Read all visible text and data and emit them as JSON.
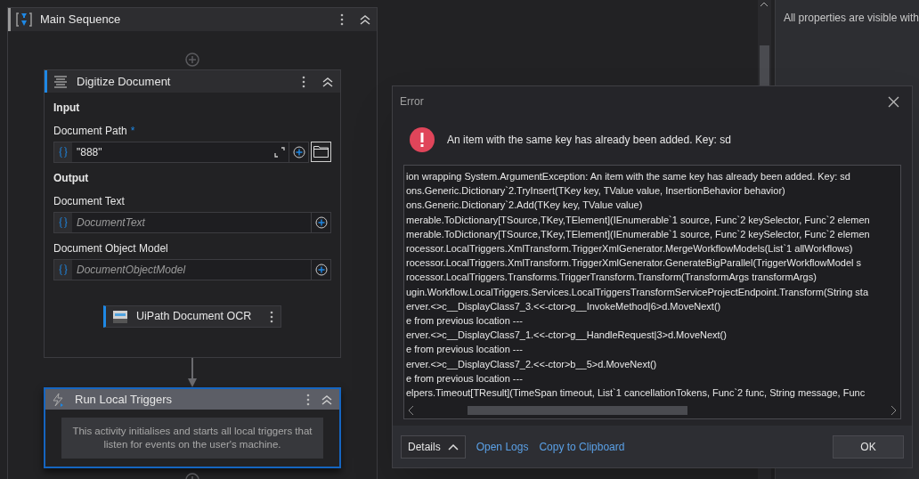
{
  "sequence": {
    "title": "Main Sequence"
  },
  "digitize": {
    "title": "Digitize Document",
    "sections": [
      {
        "heading": "Input",
        "fields": [
          {
            "label": "Document Path",
            "required_mark": "*",
            "value": "\"888\"",
            "kind": "path"
          }
        ]
      },
      {
        "heading": "Output",
        "fields": [
          {
            "label": "Document Text",
            "placeholder": "DocumentText",
            "kind": "variable"
          },
          {
            "label": "Document Object Model",
            "placeholder": "DocumentObjectModel",
            "kind": "variable"
          }
        ]
      }
    ],
    "ocr": {
      "title": "UiPath Document OCR"
    }
  },
  "triggers": {
    "title": "Run Local Triggers",
    "selected": true,
    "description": "This activity initialises and starts all local triggers that listen for events on the user's machine."
  },
  "properties": {
    "hint": "All properties are visible with"
  },
  "dialog": {
    "title": "Error",
    "message": "An item with the same key has already been added. Key: sd",
    "details": [
      "ion wrapping System.ArgumentException: An item with the same key has already been added. Key: sd",
      "ons.Generic.Dictionary`2.TryInsert(TKey key, TValue value, InsertionBehavior behavior)",
      "ons.Generic.Dictionary`2.Add(TKey key, TValue value)",
      "merable.ToDictionary[TSource,TKey,TElement](IEnumerable`1 source, Func`2 keySelector, Func`2 elemen",
      "merable.ToDictionary[TSource,TKey,TElement](IEnumerable`1 source, Func`2 keySelector, Func`2 elemen",
      "rocessor.LocalTriggers.XmlTransform.TriggerXmlGenerator.MergeWorkflowModels(List`1 allWorkflows)",
      "rocessor.LocalTriggers.XmlTransform.TriggerXmlGenerator.GenerateBigParallel(TriggerWorkflowModel s",
      "rocessor.LocalTriggers.Transforms.TriggerTransform.Transform(TransformArgs transformArgs)",
      "ugin.Workflow.LocalTriggers.Services.LocalTriggersTransformServiceProjectEndpoint.Transform(String sta",
      "erver.<>c__DisplayClass7_3.<<-ctor>g__InvokeMethod|6>d.MoveNext()",
      "e from previous location ---",
      "erver.<>c__DisplayClass7_1.<<-ctor>g__HandleRequest|3>d.MoveNext()",
      "e from previous location ---",
      "erver.<>c__DisplayClass7_2.<<-ctor>b__5>d.MoveNext()",
      "e from previous location ---",
      "elpers.Timeout[TResult](TimeSpan timeout, List`1 cancellationTokens, Func`2 func, String message, Func"
    ],
    "details_button": {
      "label": "Details",
      "expanded": true
    },
    "links": [
      "Open Logs",
      "Copy to Clipboard"
    ],
    "ok": "OK"
  }
}
